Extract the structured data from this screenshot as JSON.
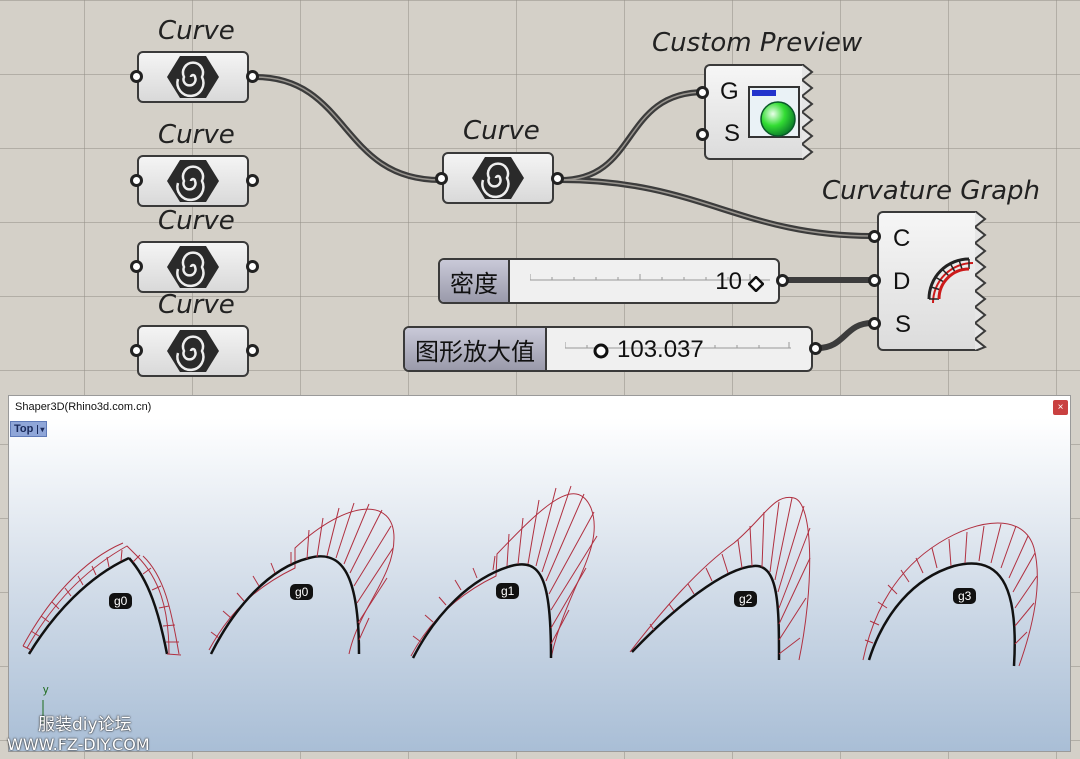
{
  "canvas": {
    "curve_title": "Curve",
    "custom_preview": {
      "title": "Custom Preview",
      "inputs": [
        "G",
        "S"
      ]
    },
    "curvature_graph": {
      "title": "Curvature Graph",
      "inputs": [
        "C",
        "D",
        "S"
      ]
    },
    "slider_density": {
      "name": "密度",
      "value": "10"
    },
    "slider_scale": {
      "name": "图形放大值",
      "value": "103.037"
    }
  },
  "viewport": {
    "window_title": "Shaper3D(Rhino3d.com.cn)",
    "close_label": "×",
    "view_tab": "Top",
    "view_menu_arrow": "▾",
    "axis_y": "y",
    "tags": [
      "g0",
      "g0",
      "g1",
      "g2",
      "g3"
    ]
  },
  "watermark": {
    "line1": "服装diy论坛",
    "line2": "WWW.FZ-DIY.COM"
  },
  "colors": {
    "canvas_bg": "#d4d0c8",
    "wire": "#3c3c3c",
    "graph_line": "#b03040",
    "curve": "#111111"
  }
}
